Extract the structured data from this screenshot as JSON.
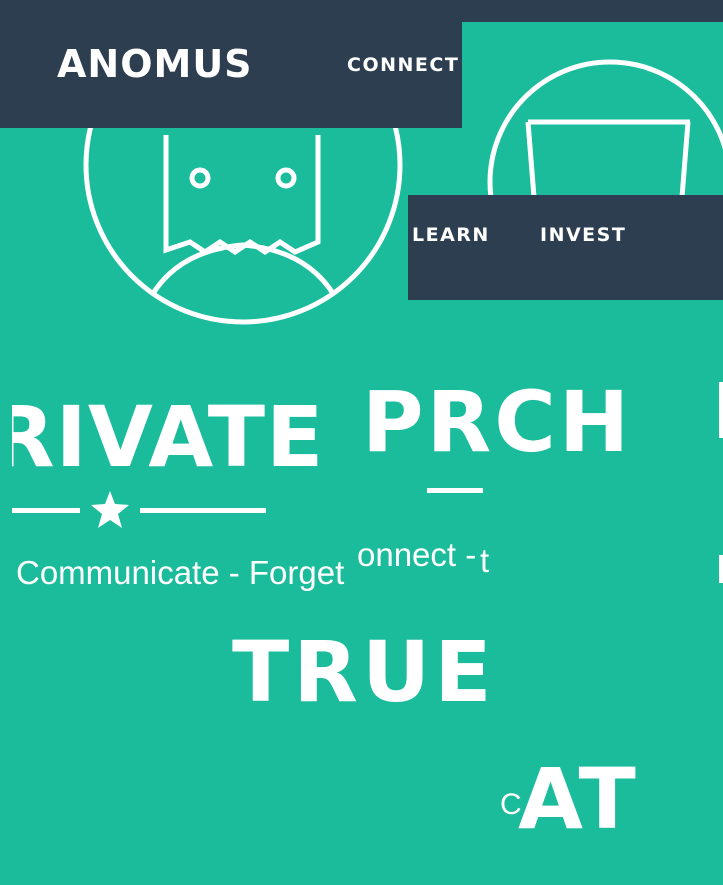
{
  "brand": {
    "name": "ANOMUS"
  },
  "nav": {
    "connect": "CONNECT",
    "learn": "LEARN",
    "invest": "INVEST"
  },
  "hero": {
    "word_left": "RIVATE",
    "word_center": "PRCH",
    "word_true": "TRUE",
    "word_at": "AT",
    "tagline_left": "Communicate - Forget",
    "tagline_center": "onnect -",
    "tagline_center_tail": "t",
    "fragment_c": "C"
  },
  "colors": {
    "primary": "#1abc9c",
    "navbar": "#2c3e50",
    "text": "#ffffff"
  },
  "icons": [
    "anonymous-mask-icon",
    "star-icon"
  ]
}
